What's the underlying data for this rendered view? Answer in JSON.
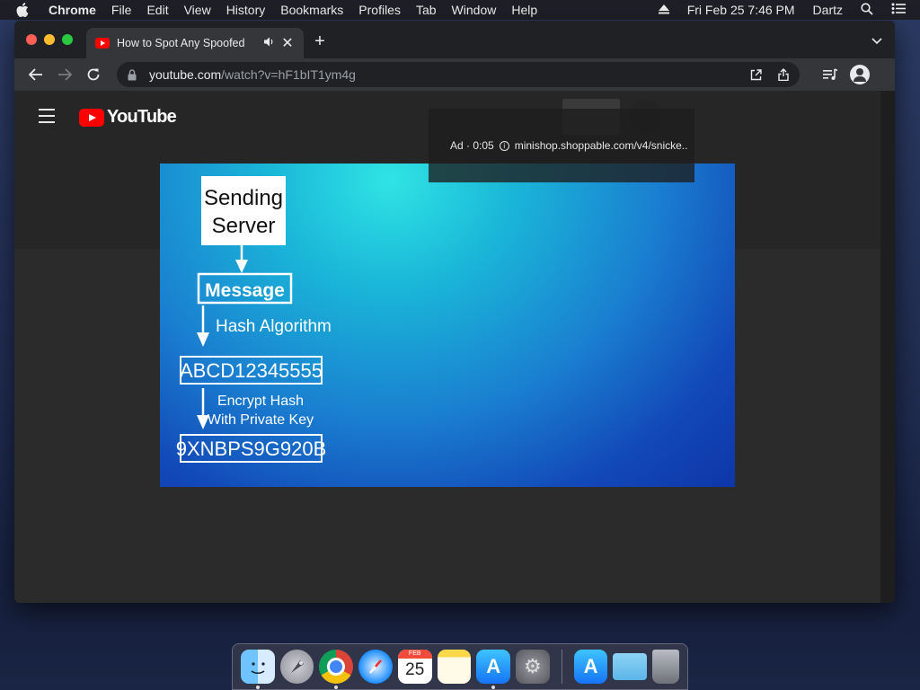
{
  "menubar": {
    "app_name": "Chrome",
    "items": [
      "File",
      "Edit",
      "View",
      "History",
      "Bookmarks",
      "Profiles",
      "Tab",
      "Window",
      "Help"
    ],
    "datetime": "Fri Feb 25  7:46 PM",
    "user": "Dartz"
  },
  "browser": {
    "tab_title": "How to Spot Any Spoofed",
    "url_host": "youtube.com",
    "url_path": "/watch?v=hF1bIT1ym4g"
  },
  "youtube": {
    "logo_text": "YouTube",
    "ad": {
      "label": "Ad · 0:05",
      "url": "minishop.shoppable.com/v4/snicke.."
    }
  },
  "video_diagram": {
    "sender": [
      "Sending",
      "Server"
    ],
    "message": "Message",
    "step1": "Hash Algorithm",
    "hash": "ABCD12345555",
    "step2": [
      "Encrypt Hash",
      "With Private Key"
    ],
    "encrypted": "9XNBPS9G920B"
  },
  "dock": {
    "calendar_month": "FEB",
    "calendar_day": "25"
  },
  "colors": {
    "youtube_red": "#ff0000",
    "chrome_dark": "#202124",
    "chrome_toolbar": "#35363a",
    "video_cyan": "#2fe4e4",
    "video_blue": "#0e36a8"
  }
}
